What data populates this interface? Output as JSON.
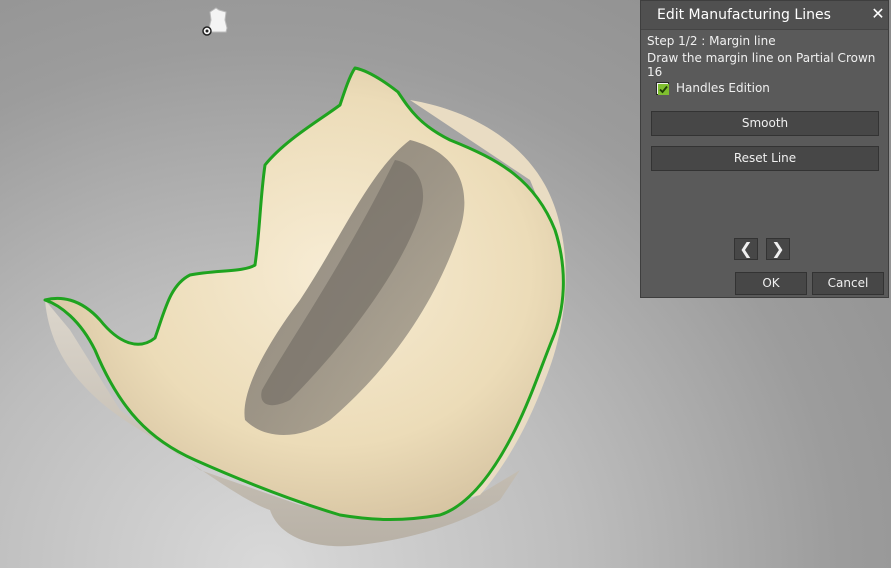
{
  "panel": {
    "title": "Edit Manufacturing Lines",
    "close_symbol": "✕",
    "step": "Step 1/2 : Margin line",
    "instruction": "Draw the margin line on Partial Crown 16",
    "handles_label": "Handles Edition",
    "handles_checked": true,
    "smooth_label": "Smooth",
    "reset_label": "Reset Line",
    "prev_symbol": "❮",
    "next_symbol": "❯",
    "ok_label": "OK",
    "cancel_label": "Cancel"
  },
  "viewport": {
    "margin_line_color": "#1fa31f",
    "view_icon": "tooth-view-icon"
  }
}
